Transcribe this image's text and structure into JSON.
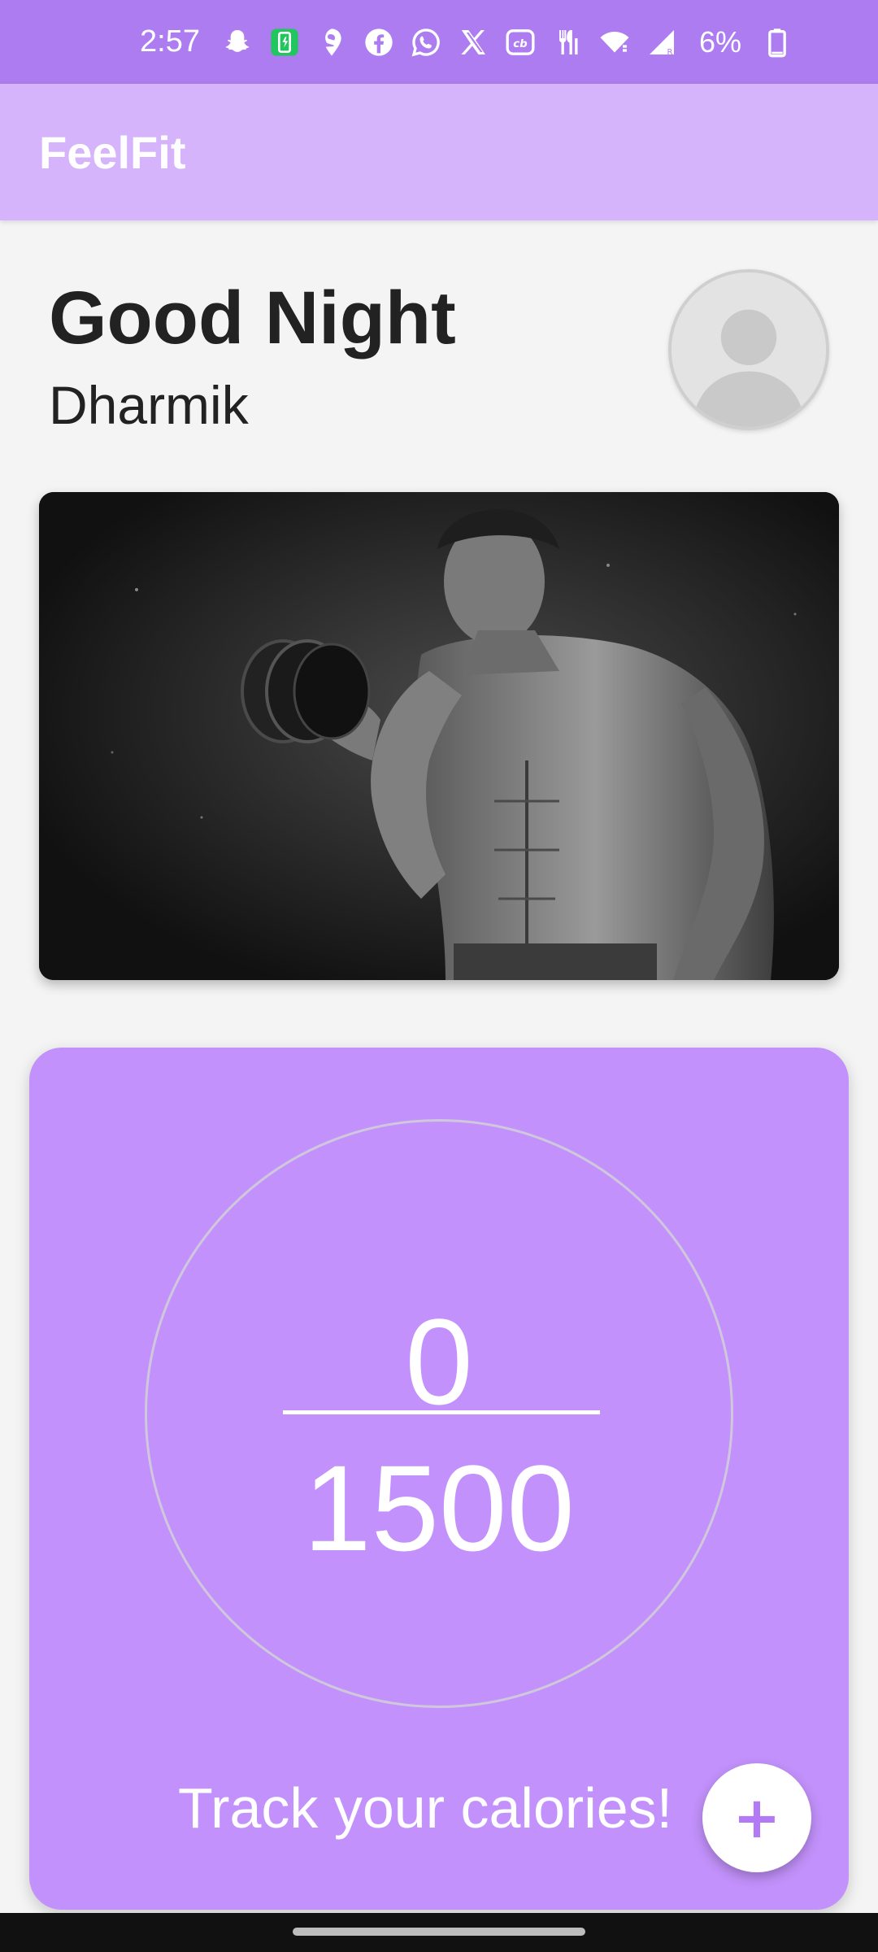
{
  "status_bar": {
    "time": "2:57",
    "battery_percent": "6%",
    "icons": [
      "snapchat-icon",
      "battery-saver-icon",
      "swiggy-icon",
      "facebook-icon",
      "whatsapp-icon",
      "x-icon",
      "cricbuzz-icon",
      "zomato-icon",
      "wifi-icon",
      "signal-icon",
      "battery-icon"
    ]
  },
  "app_bar": {
    "title": "FeelFit"
  },
  "greeting": {
    "title": "Good Night",
    "name": "Dharmik"
  },
  "calories": {
    "current": "0",
    "goal": "1500",
    "label": "Track your calories!",
    "add_label": "+"
  },
  "colors": {
    "status_bar": "#ad7cf0",
    "app_bar": "#d5b4fb",
    "card": "#c291fb",
    "fab_icon": "#b37af5"
  }
}
